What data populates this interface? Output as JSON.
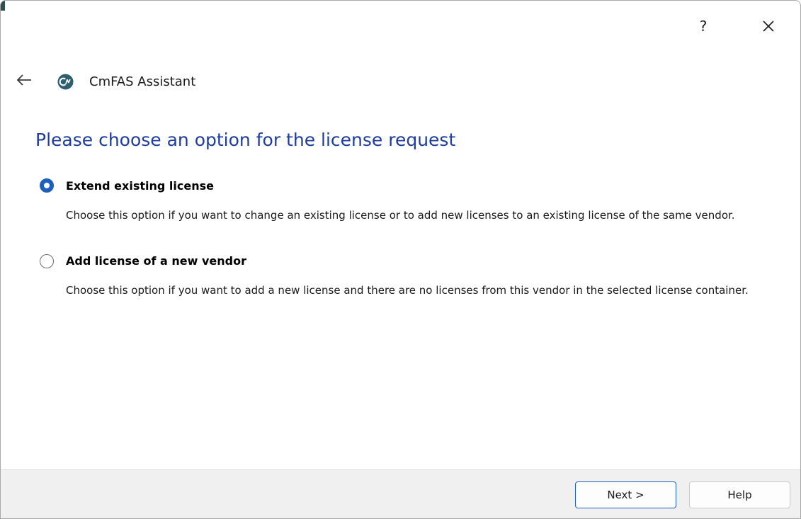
{
  "window": {
    "help_glyph": "?",
    "close_icon": "close-icon"
  },
  "header": {
    "back_icon": "back-arrow-icon",
    "app_icon": "cmfas-logo-icon",
    "app_name": "CmFAS Assistant"
  },
  "main": {
    "heading": "Please choose an option for the license request",
    "options": [
      {
        "label": "Extend existing license",
        "description": "Choose this option if you want to change an existing license or to add new licenses to an existing license of the same vendor.",
        "selected": true
      },
      {
        "label": "Add license of a new vendor",
        "description": "Choose this option if you want to add a new license and there are no licenses from this vendor in the selected license container.",
        "selected": false
      }
    ]
  },
  "footer": {
    "next_label": "Next >",
    "help_label": "Help"
  },
  "colors": {
    "heading": "#1f3d9a",
    "accent": "#1d5fbf",
    "footer_bg": "#f0f0f0",
    "logo": "#2f5f6f"
  }
}
